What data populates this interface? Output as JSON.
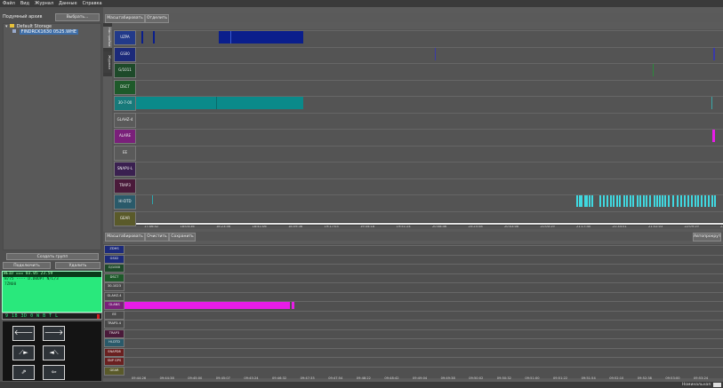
{
  "menu": [
    "Файл",
    "Вид",
    "Журнал",
    "Данные",
    "Справка"
  ],
  "left_panel": {
    "title": "Подумный архив",
    "select_button": "Выбрать...",
    "tree_root": "Default Storage",
    "tree_child": "FINDRCK1630 0525.WHE",
    "create_group_button": "Создать групп",
    "connect_button": "Подключить",
    "delete_button": "Удалить"
  },
  "status_panel": {
    "line1": "WE1D  ===  03.05  23.59",
    "line2": "8/75 ---- D.D0UPT  N/L/3",
    "line3": "7ZN00",
    "bottom_code": "9 1B 3D 0 W B T L"
  },
  "upper": {
    "toolbar_buttons": [
      "Масштабировать",
      "Отделить"
    ],
    "side_tabs": [
      "Настройки",
      "Журнал"
    ],
    "tracks": [
      {
        "label": "UZPA",
        "bg": "#223a8a"
      },
      {
        "label": "GS00",
        "bg": "#1c2a7a"
      },
      {
        "label": "G/1011",
        "bg": "#1e4a2a"
      },
      {
        "label": "DSCT",
        "bg": "#1e5a2a"
      },
      {
        "label": "30-7-00",
        "bg": "#187a7a"
      },
      {
        "label": "GLAHZ-4",
        "bg": "#5a5a5a"
      },
      {
        "label": "ALARE",
        "bg": "#7a207a"
      },
      {
        "label": "EE",
        "bg": "#5a5a5a"
      },
      {
        "label": "SNAPU-L",
        "bg": "#3a2050"
      },
      {
        "label": "TRAP3",
        "bg": "#4a1a3a"
      },
      {
        "label": "HI-DTD",
        "bg": "#2a5a6a"
      },
      {
        "label": "GEAR",
        "bg": "#5a5a2a"
      }
    ],
    "time_ticks": [
      "17:46:42",
      "18:04:36",
      "18:23:56",
      "18:41:06",
      "18:59:36",
      "19:17:03",
      "19:34:18",
      "19:51:24",
      "20:08:46",
      "20:25:58",
      "20:43:08",
      "21:00:19",
      "21:17:40",
      "21:34:51",
      "21:52:03",
      "22:09:19",
      "22:26:36"
    ]
  },
  "lower": {
    "toolbar_buttons": [
      "Масштабировать",
      "Очистить",
      "Сохранить"
    ],
    "right_button": "Автопрокрутка",
    "tracks": [
      {
        "label": "ZDHS",
        "bg": "#1c2a7a"
      },
      {
        "label": "GS02",
        "bg": "#1c2a7a"
      },
      {
        "label": "G/1000",
        "bg": "#1e4a2a"
      },
      {
        "label": "DSCT",
        "bg": "#1e5a2a"
      },
      {
        "label": "30-1023",
        "bg": "#4a4a4a"
      },
      {
        "label": "GLAHZ-4",
        "bg": "#4a4a4a"
      },
      {
        "label": "GLANS",
        "bg": "#7a207a"
      },
      {
        "label": "EE",
        "bg": "#4a4a4a"
      },
      {
        "label": "TRAP3-4",
        "bg": "#4a4a4a"
      },
      {
        "label": "TRAP3",
        "bg": "#4a1a3a"
      },
      {
        "label": "HI-DTD",
        "bg": "#2a5a6a"
      },
      {
        "label": "SNAPD8",
        "bg": "#6a2020"
      },
      {
        "label": "SNP GPS",
        "bg": "#6a2020"
      },
      {
        "label": "GEAR",
        "bg": "#5a5a2a"
      }
    ],
    "time_ticks": [
      "09:44:26",
      "09:44:38",
      "09:45:00",
      "09:45:07",
      "09:45:24",
      "09:46:32",
      "09:47:35",
      "09:47:54",
      "09:48:22",
      "09:48:42",
      "09:49:04",
      "09:49:38",
      "09:50:02",
      "09:50:32",
      "09:51:00",
      "09:51:22",
      "09:51:54",
      "09:52:10",
      "09:52:38",
      "09:53:00",
      "09:53:24"
    ]
  },
  "colors": {
    "blue_event": "#0a1e8c",
    "teal_event": "#0a8a8a",
    "cyan_event": "#40d8e0",
    "magenta_event": "#e81ce8",
    "green_panel": "#29e87c"
  },
  "status_bar": {
    "right_text": "Номинальная"
  }
}
